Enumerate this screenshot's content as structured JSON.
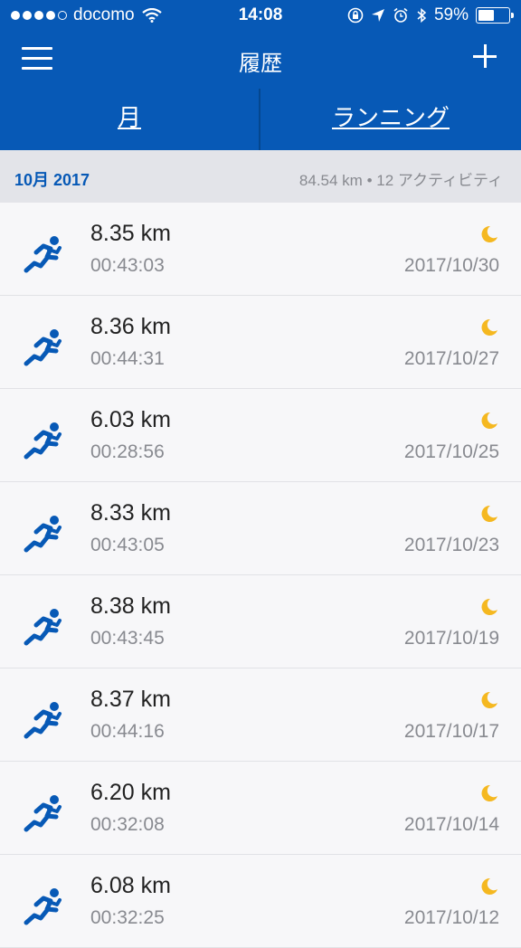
{
  "status_bar": {
    "carrier": "docomo",
    "time": "14:08",
    "battery": "59%",
    "battery_level": 0.59,
    "signal_bars": 4
  },
  "nav": {
    "title": "履歴"
  },
  "tabs": {
    "month": "月",
    "running": "ランニング"
  },
  "month_header": {
    "label": "10月 2017",
    "summary": "84.54 km • 12 アクティビティ"
  },
  "activities": [
    {
      "distance": "8.35 km",
      "duration": "00:43:03",
      "date": "2017/10/30",
      "icon": "running-icon",
      "time_of_day_icon": "moon-icon"
    },
    {
      "distance": "8.36 km",
      "duration": "00:44:31",
      "date": "2017/10/27",
      "icon": "running-icon",
      "time_of_day_icon": "moon-icon"
    },
    {
      "distance": "6.03 km",
      "duration": "00:28:56",
      "date": "2017/10/25",
      "icon": "running-icon",
      "time_of_day_icon": "moon-icon"
    },
    {
      "distance": "8.33 km",
      "duration": "00:43:05",
      "date": "2017/10/23",
      "icon": "running-icon",
      "time_of_day_icon": "moon-icon"
    },
    {
      "distance": "8.38 km",
      "duration": "00:43:45",
      "date": "2017/10/19",
      "icon": "running-icon",
      "time_of_day_icon": "moon-icon"
    },
    {
      "distance": "8.37 km",
      "duration": "00:44:16",
      "date": "2017/10/17",
      "icon": "running-icon",
      "time_of_day_icon": "moon-icon"
    },
    {
      "distance": "6.20 km",
      "duration": "00:32:08",
      "date": "2017/10/14",
      "icon": "running-icon",
      "time_of_day_icon": "moon-icon"
    },
    {
      "distance": "6.08 km",
      "duration": "00:32:25",
      "date": "2017/10/12",
      "icon": "running-icon",
      "time_of_day_icon": "moon-icon"
    }
  ],
  "colors": {
    "brand_blue": "#0759b6",
    "moon_yellow": "#f5b820",
    "secondary_text": "#888a90"
  }
}
